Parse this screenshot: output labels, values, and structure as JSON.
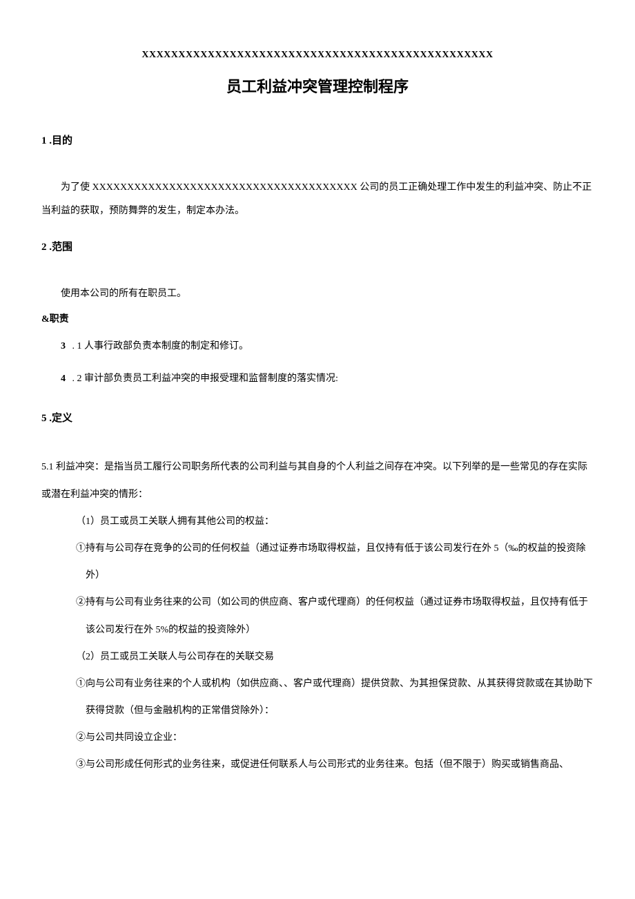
{
  "header_x_line": "XXXXXXXXXXXXXXXXXXXXXXXXXXXXXXXXXXXXXXXXXXXXXXXX",
  "main_title": "员工利益冲突管理控制程序",
  "section1": {
    "heading": "1 .目的",
    "body": "为了使 XXXXXXXXXXXXXXXXXXXXXXXXXXXXXXXXXXXXXX 公司的员工正确处理工作中发生的利益冲突、防止不正当利益的获取，预防舞弊的发生，制定本办法。"
  },
  "section2": {
    "heading": "2 .范围",
    "body": "使用本公司的所有在职员工。"
  },
  "section3": {
    "heading": "&职责",
    "item1_num": "3",
    "item1_text": " . 1 人事行政部负责本制度的制定和修订。",
    "item2_num": "4",
    "item2_text": " . 2 审计部负责员工利益冲突的申报受理和监督制度的落实情况:"
  },
  "section5": {
    "heading": "5 .定义",
    "main": "5.1 利益冲突：是指当员工履行公司职务所代表的公司利益与其自身的个人利益之间存在冲突。以下列举的是一些常见的存在实际或潜在利益冲突的情形：",
    "sub1_title": "（1）员工或员工关联人拥有其他公司的权益：",
    "sub1_item1": "①持有与公司存在竞争的公司的任何权益（通过证券市场取得权益，且仅持有低于该公司发行在外 5（‰的权益的投资除外）",
    "sub1_item2": "②持有与公司有业务往来的公司（如公司的供应商、客户或代理商）的任何权益（通过证券市场取得权益，且仅持有低于该公司发行在外 5%的权益的投资除外）",
    "sub2_title": "（2）员工或员工关联人与公司存在的关联交易",
    "sub2_item1": "①向与公司有业务往来的个人或机构（如供应商、、客户或代理商）提供贷款、为其担保贷款、从其获得贷款或在其协助下获得贷款（但与金融机构的正常借贷除外）：",
    "sub2_item2": "②与公司共同设立企业：",
    "sub2_item3": "③与公司形成任何形式的业务往来，或促进任何联系人与公司形式的业务往来。包括（但不限于）购买或销售商品、"
  }
}
